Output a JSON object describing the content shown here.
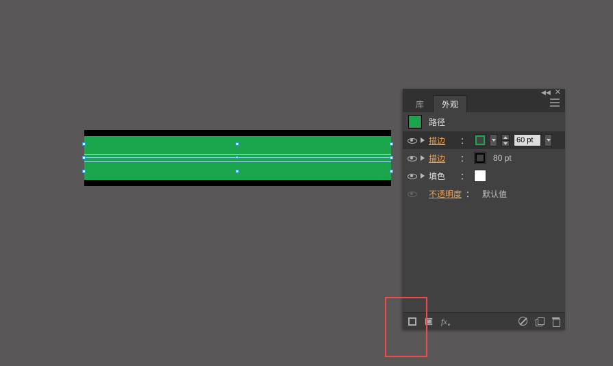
{
  "tabs": {
    "library": "库",
    "appearance": "外观"
  },
  "header": {
    "object_type": "路径"
  },
  "rows": {
    "stroke1": {
      "label": "描边",
      "weight": "60 pt"
    },
    "stroke2": {
      "label": "描边",
      "weight": "80 pt"
    },
    "fill": {
      "label": "填色"
    },
    "opacity": {
      "label": "不透明度",
      "value": "默认值"
    }
  },
  "footer": {
    "fx": "fx"
  }
}
